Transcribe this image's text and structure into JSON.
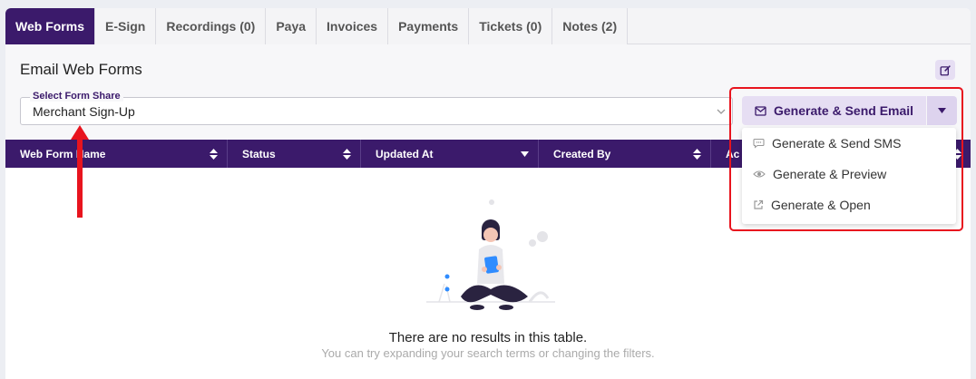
{
  "tabs": [
    {
      "label": "Web Forms",
      "active": true
    },
    {
      "label": "E-Sign"
    },
    {
      "label": "Recordings (0)"
    },
    {
      "label": "Paya"
    },
    {
      "label": "Invoices"
    },
    {
      "label": "Payments"
    },
    {
      "label": "Tickets (0)"
    },
    {
      "label": "Notes (2)"
    }
  ],
  "section": {
    "title": "Email Web Forms",
    "edit_icon": "edit-icon"
  },
  "form_share": {
    "legend": "Select Form Share",
    "value": "Merchant Sign-Up"
  },
  "table": {
    "columns": [
      "Web Form Name",
      "Status",
      "Updated At",
      "Created By",
      "Ac"
    ],
    "empty_title": "There are no results in this table.",
    "empty_subtitle": "You can try expanding your search terms or changing the filters."
  },
  "generate": {
    "main_label": "Generate & Send Email",
    "menu": [
      {
        "label": "Generate & Send SMS",
        "icon": "chat-icon"
      },
      {
        "label": "Generate & Preview",
        "icon": "eye-icon"
      },
      {
        "label": "Generate & Open",
        "icon": "external-link-icon"
      }
    ]
  },
  "colors": {
    "primary": "#3b1a6b",
    "accent_light": "#e6def3",
    "annotation": "#e8141e"
  }
}
